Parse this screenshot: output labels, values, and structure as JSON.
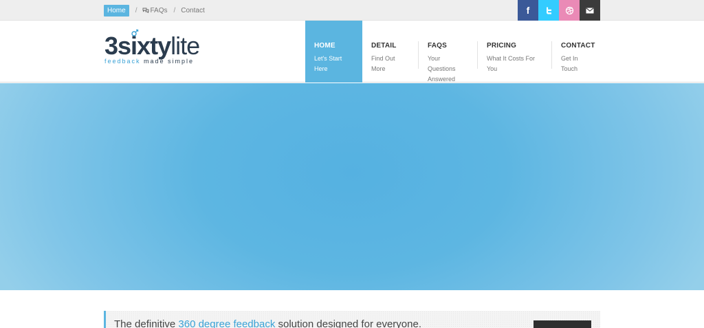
{
  "breadcrumb": {
    "items": [
      {
        "label": "Home",
        "active": true
      },
      {
        "label": "FAQs",
        "icon": "chat-bubbles-icon"
      },
      {
        "label": "Contact"
      }
    ],
    "separator": "/"
  },
  "social": [
    {
      "name": "facebook",
      "glyph": "f",
      "color": "#3b5998"
    },
    {
      "name": "twitter",
      "color": "#33ccff"
    },
    {
      "name": "dribbble",
      "color": "#ea8ab6"
    },
    {
      "name": "email",
      "color": "#3b3b3b"
    }
  ],
  "logo": {
    "num": "3",
    "sixty": "sixty",
    "lite": "lite",
    "tag_feedback": "feedback",
    "tag_rest": " made simple"
  },
  "nav": [
    {
      "title": "HOME",
      "sub": "Let's Start Here",
      "active": true
    },
    {
      "title": "DETAIL",
      "sub": "Find Out More"
    },
    {
      "title": "FAQS",
      "sub_line1": "Your Questions",
      "sub_line2": "Answered"
    },
    {
      "title": "PRICING",
      "sub": "What It Costs For You"
    },
    {
      "title": "CONTACT",
      "sub": "Get In Touch"
    }
  ],
  "hero": {
    "color": "#5bb5e0"
  },
  "intro": {
    "before": "The definitive ",
    "highlight": "360 degree feedback",
    "after": " solution designed for everyone."
  },
  "colors": {
    "accent": "#5bb5e0",
    "dark": "#2b3c4e"
  }
}
